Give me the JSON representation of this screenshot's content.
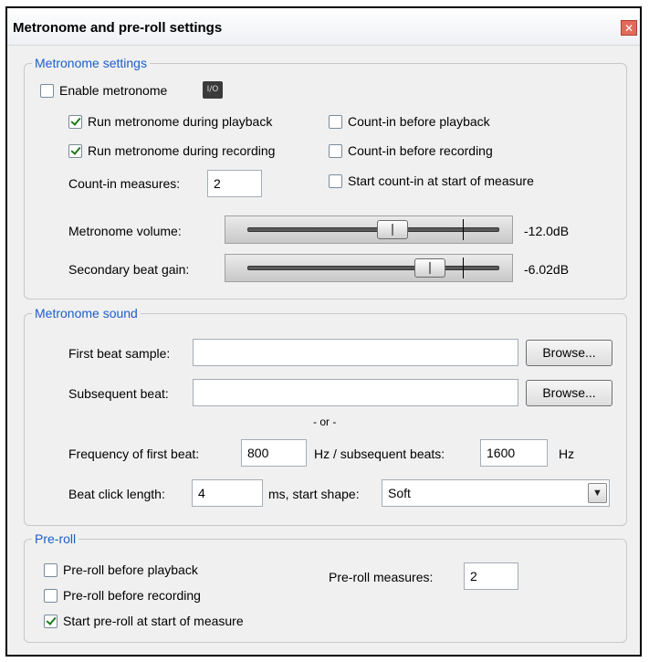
{
  "window": {
    "title": "Metronome and pre-roll settings",
    "close_glyph": "✕"
  },
  "metronome_settings": {
    "group_title": "Metronome settings",
    "enable": {
      "label": "Enable metronome",
      "checked": false,
      "io_label": "I/O"
    },
    "run_playback": {
      "label": "Run metronome during playback",
      "checked": true
    },
    "run_recording": {
      "label": "Run metronome during recording",
      "checked": true
    },
    "countin_playback": {
      "label": "Count-in before playback",
      "checked": false
    },
    "countin_recording": {
      "label": "Count-in before recording",
      "checked": false
    },
    "countin_start_measure": {
      "label": "Start count-in at start of measure",
      "checked": false
    },
    "countin_measures": {
      "label": "Count-in measures:",
      "value": "2"
    },
    "volume": {
      "label": "Metronome volume:",
      "value_text": "-12.0dB"
    },
    "secondary_gain": {
      "label": "Secondary beat gain:",
      "value_text": "-6.02dB"
    }
  },
  "metronome_sound": {
    "group_title": "Metronome sound",
    "first_beat": {
      "label": "First beat sample:",
      "value": "",
      "browse": "Browse..."
    },
    "subsequent_beat": {
      "label": "Subsequent beat:",
      "value": "",
      "browse": "Browse..."
    },
    "or_text": "- or -",
    "freq_first": {
      "label": "Frequency of first beat:",
      "value": "800"
    },
    "freq_subsequent": {
      "label": "Hz / subsequent beats:",
      "value": "1600",
      "unit": "Hz"
    },
    "click_length": {
      "label": "Beat click length:",
      "value": "4"
    },
    "start_shape": {
      "label": "ms, start shape:",
      "value": "Soft"
    }
  },
  "preroll": {
    "group_title": "Pre-roll",
    "before_playback": {
      "label": "Pre-roll before playback",
      "checked": false
    },
    "before_recording": {
      "label": "Pre-roll before recording",
      "checked": false
    },
    "start_measure": {
      "label": "Start pre-roll at start of measure",
      "checked": true
    },
    "measures": {
      "label": "Pre-roll measures:",
      "value": "2"
    }
  }
}
